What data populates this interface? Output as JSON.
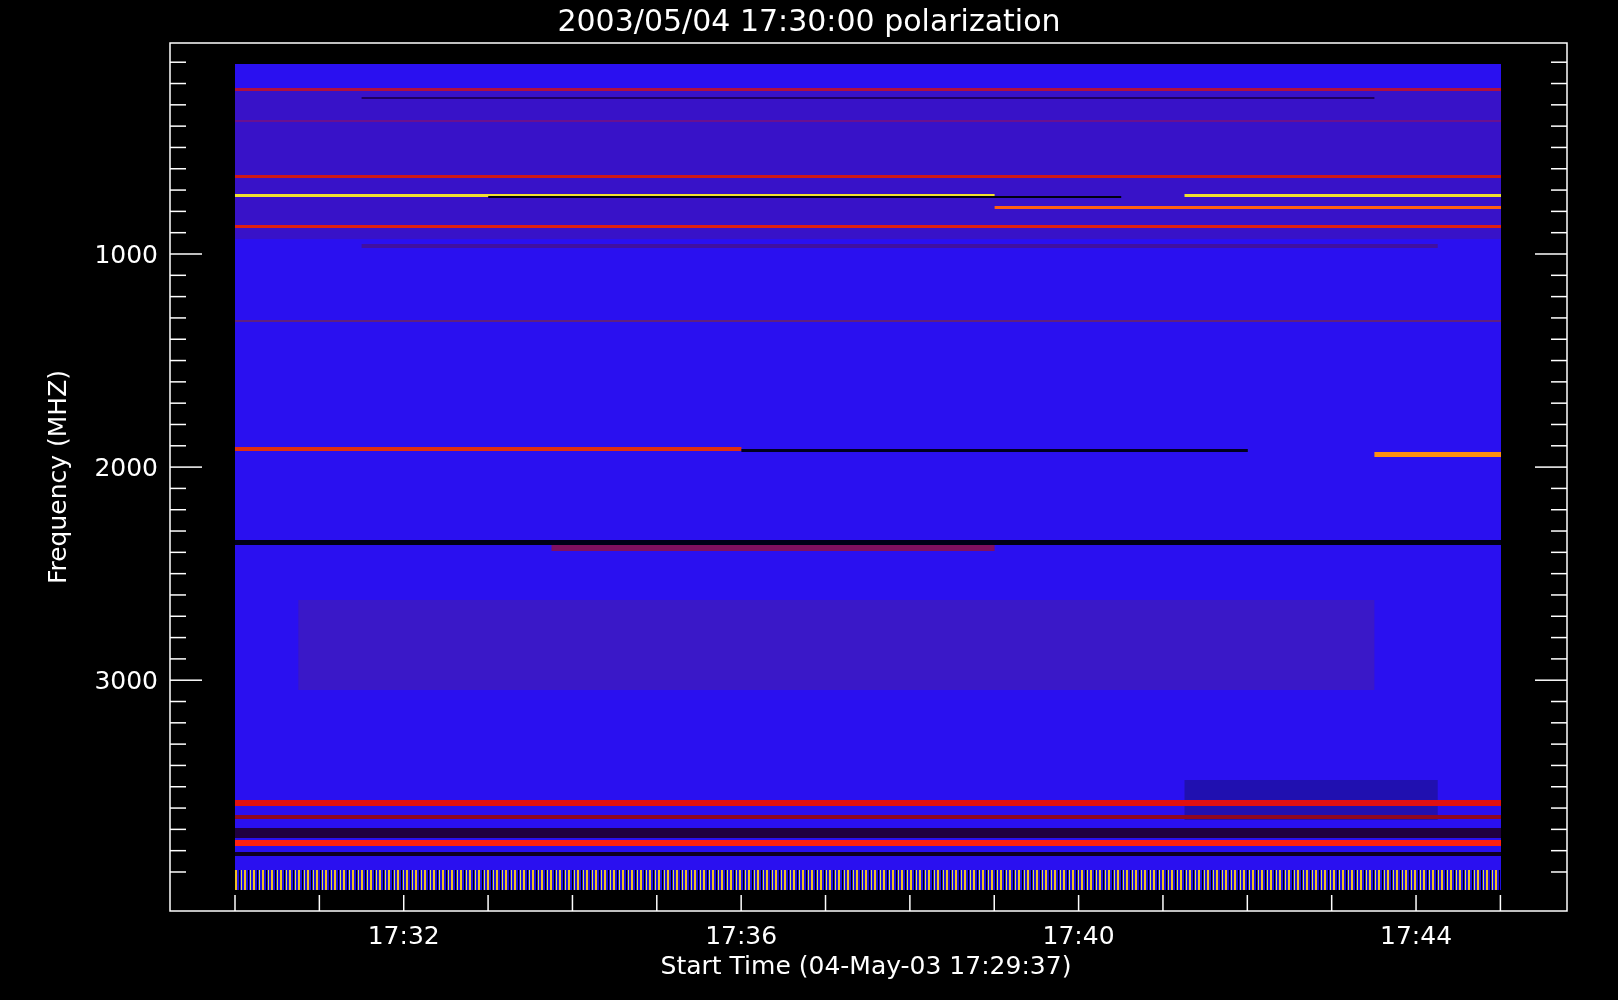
{
  "title": "2003/05/04 17:30:00 polarization",
  "y_axis": {
    "label": "Frequency (MHZ)",
    "tick_labels": [
      "1000",
      "2000",
      "3000"
    ]
  },
  "x_axis": {
    "label": "Start Time (04-May-03 17:29:37)",
    "tick_labels": [
      "17:32",
      "17:36",
      "17:40",
      "17:44"
    ]
  }
}
